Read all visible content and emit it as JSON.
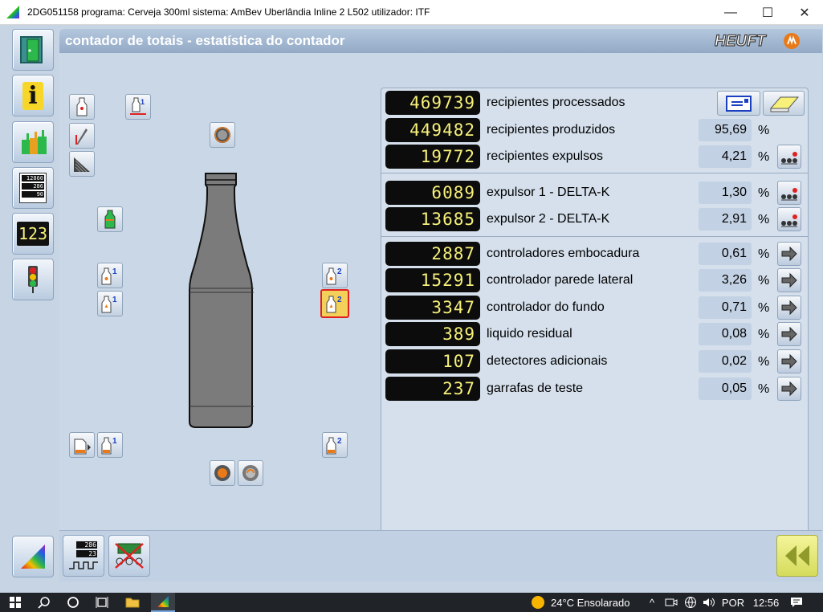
{
  "window": {
    "title": "2DG051158 programa: Cerveja 300ml  sistema: AmBev Uberlândia Inline 2 L502  utilizador: ITF",
    "minimize": "—",
    "maximize": "☐",
    "close": "✕"
  },
  "header": {
    "title": "contador de totais  - estatística do contador",
    "logo": "HEUFT"
  },
  "sidebar": {
    "items": [
      {
        "icon": "door-exit-icon"
      },
      {
        "icon": "info-icon",
        "label": "i"
      },
      {
        "icon": "bottles-icon"
      },
      {
        "icon": "counter-display-icon",
        "counter_lines": [
          "12860",
          "286",
          "90"
        ]
      },
      {
        "icon": "digital-counter-icon",
        "label": "123"
      },
      {
        "icon": "traffic-light-icon"
      }
    ],
    "bottom_icon": "color-spectrum-icon"
  },
  "top_counts": [
    {
      "value": "469739",
      "label": "recipientes processados",
      "percent": "",
      "action": "print-icon"
    },
    {
      "value": "449482",
      "label": "recipientes produzidos",
      "percent": "95,69"
    },
    {
      "value": "19772",
      "label": "recipientes expulsos",
      "percent": "4,21",
      "action": "rejector-icon"
    }
  ],
  "rejectors": [
    {
      "value": "6089",
      "label": "expulsor 1 - DELTA-K",
      "percent": "1,30"
    },
    {
      "value": "13685",
      "label": "expulsor 2 - DELTA-K",
      "percent": "2,91"
    }
  ],
  "inspections": [
    {
      "value": "2887",
      "label": "controladores embocadura",
      "percent": "0,61"
    },
    {
      "value": "15291",
      "label": "controlador parede lateral",
      "percent": "3,26"
    },
    {
      "value": "3347",
      "label": "controlador do fundo",
      "percent": "0,71"
    },
    {
      "value": "389",
      "label": "liquido residual",
      "percent": "0,08"
    },
    {
      "value": "107",
      "label": "detectores adicionais",
      "percent": "0,02"
    },
    {
      "value": "237",
      "label": "garrafas de teste",
      "percent": "0,05"
    }
  ],
  "percent_sign": "%",
  "left_panel": {
    "badges": {
      "b1": "1",
      "b2": "2"
    }
  },
  "bottom_bar": {
    "counter_lines": [
      "286",
      "23"
    ]
  },
  "taskbar": {
    "weather": "24°C  Ensolarado",
    "lang": "POR",
    "time": "12:56"
  },
  "colors": {
    "lcd_text": "#f7f17a",
    "panel_bg": "#cad7e6",
    "header_text": "#ffffff"
  }
}
